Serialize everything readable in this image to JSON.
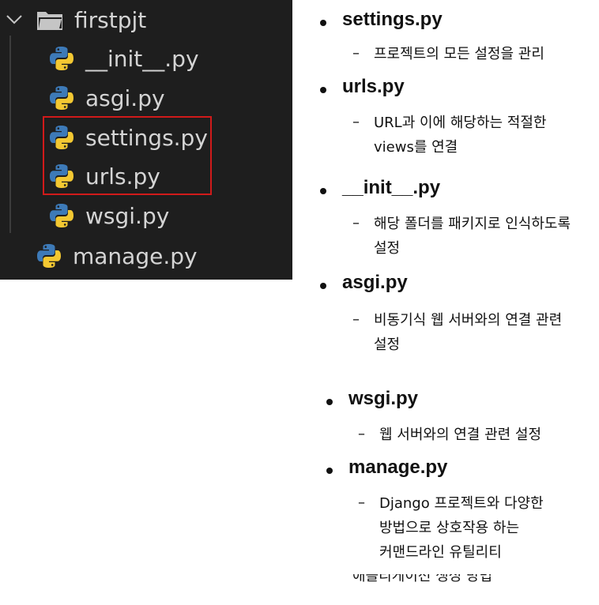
{
  "explorer": {
    "folder": {
      "label": "firstpjt",
      "icon": "folder-icon",
      "expand_icon": "chevron-down-icon"
    },
    "files": [
      {
        "label": "__init__.py",
        "icon": "python-icon"
      },
      {
        "label": "asgi.py",
        "icon": "python-icon"
      },
      {
        "label": "settings.py",
        "icon": "python-icon",
        "highlighted": true
      },
      {
        "label": "urls.py",
        "icon": "python-icon",
        "highlighted": true
      },
      {
        "label": "wsgi.py",
        "icon": "python-icon"
      }
    ],
    "root_file": {
      "label": "manage.py",
      "icon": "python-icon"
    },
    "highlight_color": "#d11a1a",
    "background": "#1e1e1e",
    "python_icon_colors": {
      "blue": "#3d7ab8",
      "yellow": "#f3c832"
    }
  },
  "notes": [
    {
      "title": "settings.py",
      "dash": "–",
      "desc": [
        "프로젝트의 모든 설정을 관리"
      ]
    },
    {
      "title": "urls.py",
      "dash": "–",
      "desc": [
        "URL과 이에 해당하는 적절한",
        "views를 연결"
      ]
    },
    {
      "title": "__init__.py",
      "dash": "–",
      "desc": [
        "해당 폴더를 패키지로 인식하도록",
        "설정"
      ]
    },
    {
      "title": "asgi.py",
      "dash": "–",
      "desc": [
        "비동기식 웹 서버와의 연결 관련",
        "설정"
      ]
    },
    {
      "title": "wsgi.py",
      "dash": "–",
      "desc": [
        "웹 서버와의 연결 관련 설정"
      ]
    },
    {
      "title": "manage.py",
      "dash": "–",
      "desc": [
        "Django 프로젝트와 다양한",
        "방법으로 상호작용 하는",
        "커맨드라인 유틸리티"
      ]
    }
  ],
  "partial_text": "애플리케이션 생성 방법"
}
